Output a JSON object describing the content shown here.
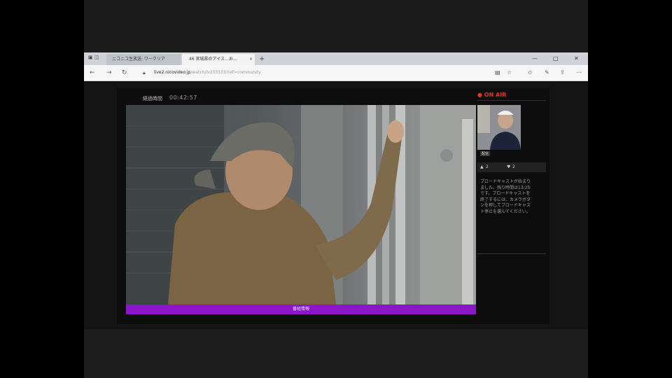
{
  "browser": {
    "tabs": [
      {
        "label": "ニコニコ生放送: ワークリア",
        "active": false
      },
      {
        "label": "46 宮城県のアイス…お…",
        "active": true
      }
    ],
    "new_tab_glyph": "+",
    "close_glyph": "×",
    "url_host": "live2.nicovideo.jp",
    "url_path": "/watch/lv333333?ref=community",
    "window_controls": [
      "—",
      "□",
      "✕"
    ]
  },
  "stream": {
    "elapsed_label": "経過時間",
    "elapsed_time": "00:42:57",
    "progress_label": "番組情報",
    "on_air_label": "● ON AIR",
    "badge": "配信",
    "viewers": "2",
    "comments": "2",
    "broadcaster_message": "ブロードキャストが始まりました。残り時間は13:25です。ブロードキャストを終了するには、カメラボタンを押してブロードキャスト停止を選んでください。"
  },
  "colors": {
    "accent_purple": "#8b16c8",
    "onair_red": "#e0352b"
  },
  "icons": [
    "back-icon",
    "forward-icon",
    "reload-icon",
    "star-icon",
    "person-icon",
    "heart-icon"
  ]
}
